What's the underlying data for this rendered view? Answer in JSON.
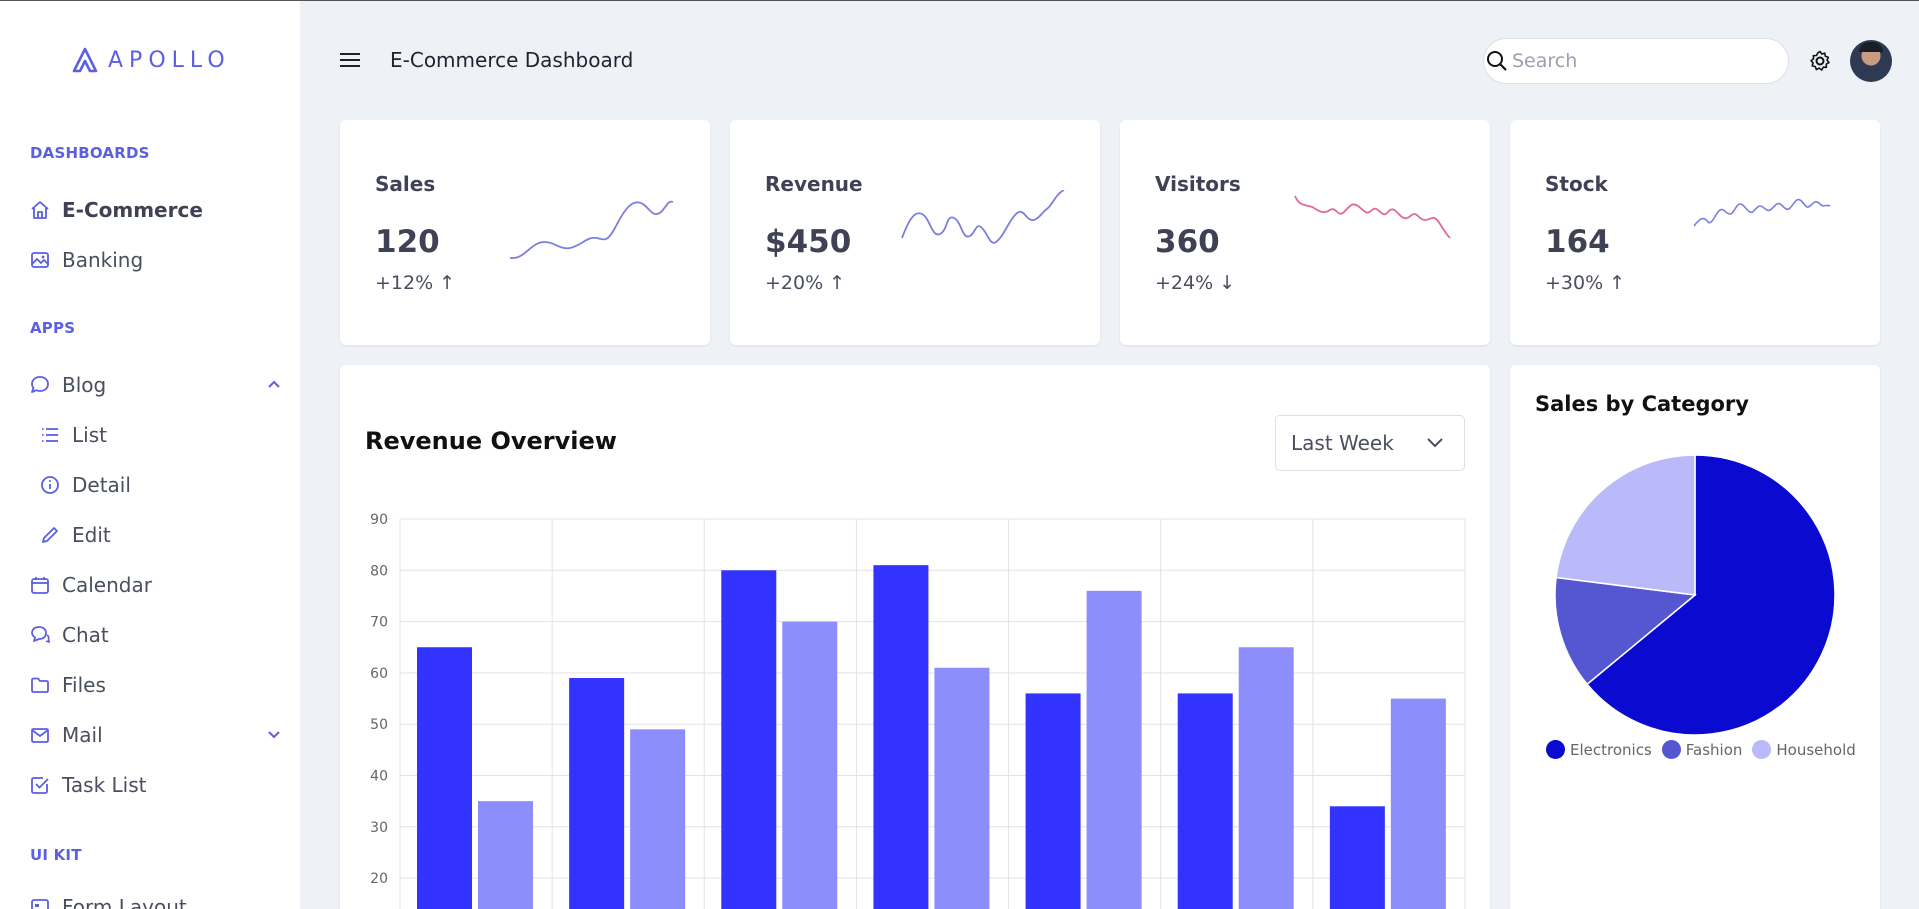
{
  "brand": {
    "name": "APOLLO"
  },
  "header": {
    "title": "E-Commerce Dashboard",
    "search_placeholder": "Search"
  },
  "sidebar": {
    "sections": [
      "DASHBOARDS",
      "APPS",
      "UI KIT"
    ],
    "dashboards": [
      "E-Commerce",
      "Banking"
    ],
    "apps": [
      "Blog",
      "List",
      "Detail",
      "Edit",
      "Calendar",
      "Chat",
      "Files",
      "Mail",
      "Task List"
    ],
    "uikit": [
      "Form Layout"
    ]
  },
  "stats": [
    {
      "label": "Sales",
      "value": "120",
      "delta": "+12% ↑",
      "color": "#7b7fdc"
    },
    {
      "label": "Revenue",
      "value": "$450",
      "delta": "+20% ↑",
      "color": "#7b7fdc"
    },
    {
      "label": "Visitors",
      "value": "360",
      "delta": "+24% ↓",
      "color": "#e06b96"
    },
    {
      "label": "Stock",
      "value": "164",
      "delta": "+30% ↑",
      "color": "#7b7fdc"
    }
  ],
  "revenue": {
    "title": "Revenue Overview",
    "period": "Last Week"
  },
  "pie": {
    "title": "Sales by Category"
  },
  "chart_data": [
    {
      "type": "bar",
      "title": "Revenue Overview",
      "categories": [
        "",
        "",
        "",
        "",
        "",
        "",
        ""
      ],
      "series": [
        {
          "values": [
            65,
            59,
            80,
            81,
            56,
            56,
            34
          ],
          "color": "#3333ff"
        },
        {
          "values": [
            35,
            49,
            70,
            61,
            76,
            65,
            55
          ],
          "color": "#8d8dfc"
        }
      ],
      "yticks": [
        "90",
        "80",
        "70",
        "60",
        "50",
        "40",
        "30",
        "20"
      ],
      "ylim": [
        20,
        90
      ],
      "grid": true
    },
    {
      "type": "pie",
      "title": "Sales by Category",
      "categories": [
        "Electronics",
        "Fashion",
        "Household"
      ],
      "values": [
        64,
        13,
        23
      ],
      "colors": [
        "#0a0ad0",
        "#5557d0",
        "#babafa"
      ],
      "legend": "bottom"
    }
  ]
}
